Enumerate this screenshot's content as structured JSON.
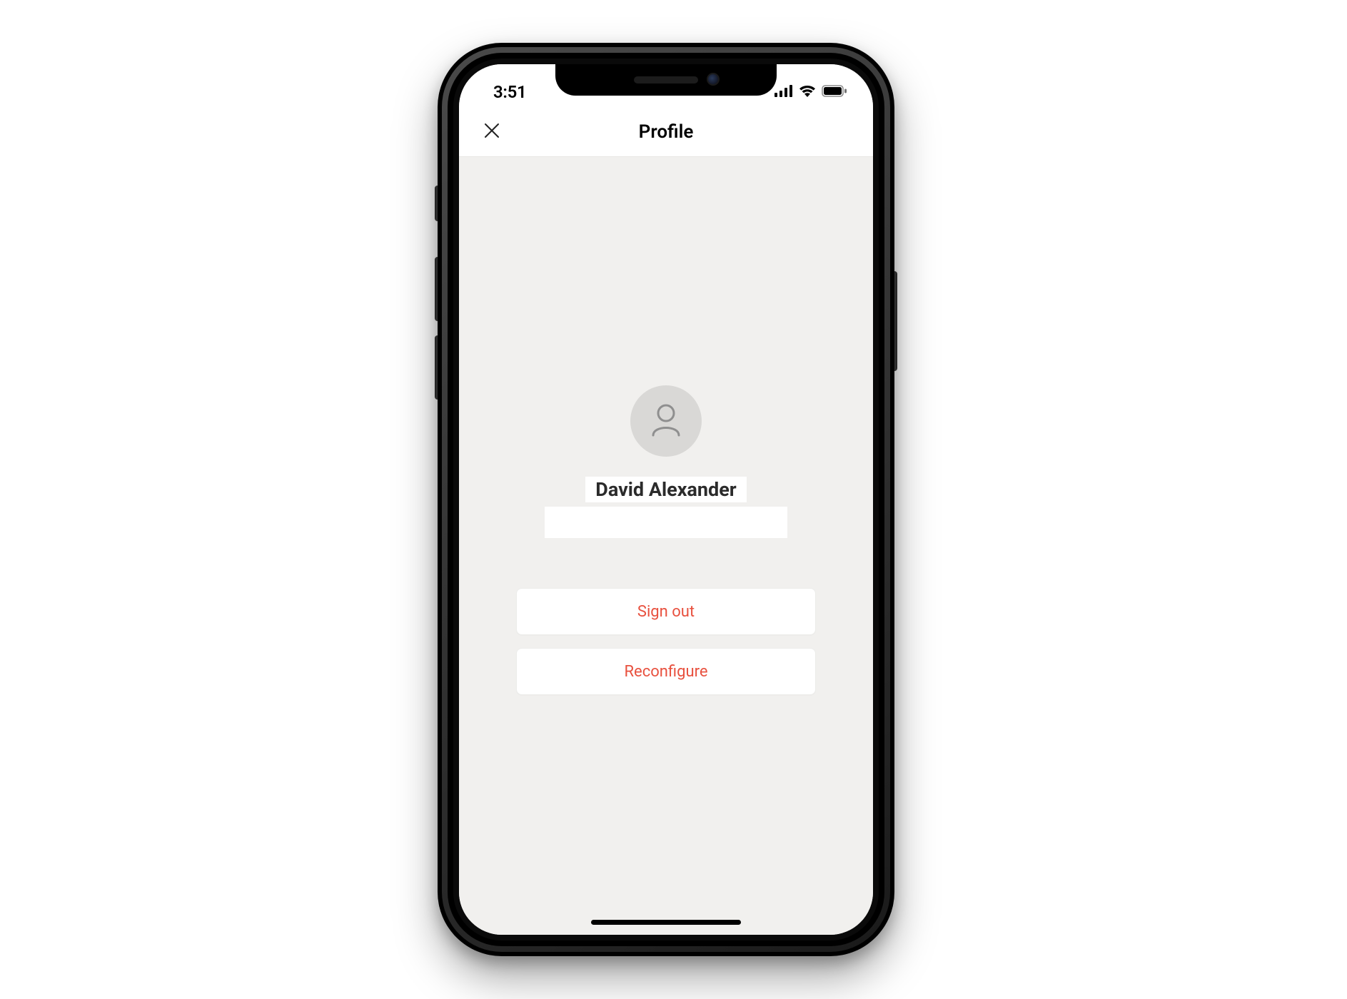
{
  "statusbar": {
    "time": "3:51"
  },
  "header": {
    "title": "Profile"
  },
  "profile": {
    "name": "David Alexander"
  },
  "actions": {
    "signout_label": "Sign out",
    "reconfigure_label": "Reconfigure"
  },
  "colors": {
    "danger": "#e8513f",
    "screen_bg": "#f1f0ee",
    "avatar_bg": "#d9d8d6"
  }
}
